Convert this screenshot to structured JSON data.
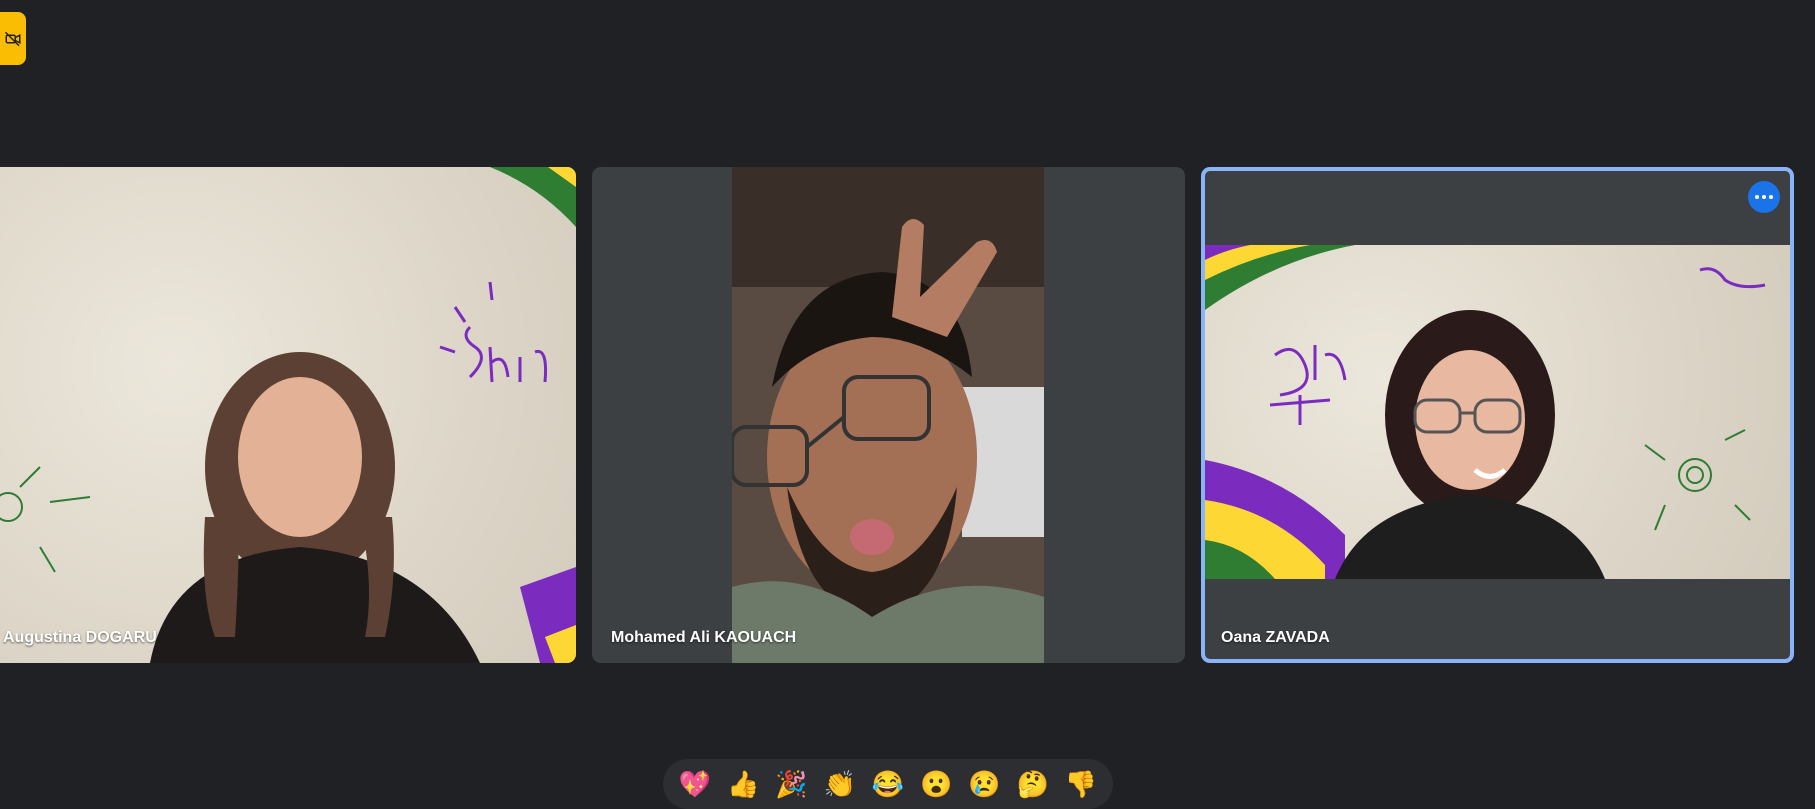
{
  "participants": [
    {
      "name": "Augustina DOGARU"
    },
    {
      "name": "Mohamed Ali KAOUACH"
    },
    {
      "name": "Oana ZAVADA"
    }
  ],
  "reactions": [
    {
      "icon": "sparkling-heart-icon",
      "glyph": "💖"
    },
    {
      "icon": "thumbs-up-icon",
      "glyph": "👍"
    },
    {
      "icon": "party-popper-icon",
      "glyph": "🎉"
    },
    {
      "icon": "clapping-hands-icon",
      "glyph": "👏"
    },
    {
      "icon": "tears-of-joy-icon",
      "glyph": "😂"
    },
    {
      "icon": "surprised-face-icon",
      "glyph": "😮"
    },
    {
      "icon": "crying-face-icon",
      "glyph": "😢"
    },
    {
      "icon": "thinking-face-icon",
      "glyph": "🤔"
    },
    {
      "icon": "thumbs-down-icon",
      "glyph": "👎"
    }
  ],
  "colors": {
    "background": "#202124",
    "tile": "#3c4043",
    "active_speaker_border": "#8ab4f8",
    "camera_off_button": "#fbbc04",
    "more_options_button": "#1a73e8"
  }
}
